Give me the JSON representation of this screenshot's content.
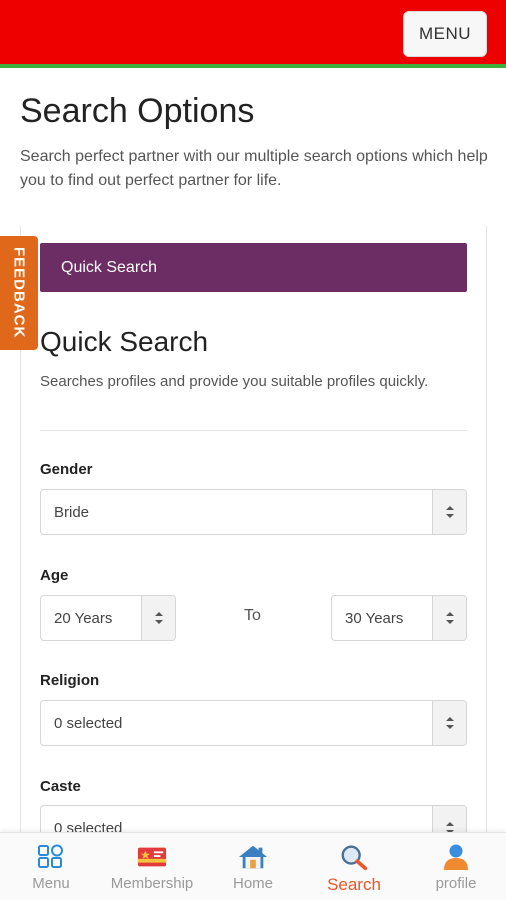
{
  "header": {
    "menu_label": "MENU"
  },
  "page": {
    "title": "Search Options",
    "description": "Search perfect partner with our multiple search options which help you to find out perfect partner for life."
  },
  "feedback_label": "FEEDBACK",
  "tab": {
    "label": "Quick Search"
  },
  "section": {
    "title": "Quick Search",
    "description": "Searches profiles and provide you suitable profiles quickly."
  },
  "form": {
    "gender": {
      "label": "Gender",
      "value": "Bride"
    },
    "age": {
      "label": "Age",
      "from": "20 Years",
      "to_label": "To",
      "to": "30 Years"
    },
    "religion": {
      "label": "Religion",
      "value": "0 selected"
    },
    "caste": {
      "label": "Caste",
      "value": "0 selected"
    }
  },
  "bottom_nav": {
    "items": [
      {
        "label": "Menu",
        "icon": "grid-icon"
      },
      {
        "label": "Membership",
        "icon": "membership-card-icon"
      },
      {
        "label": "Home",
        "icon": "home-icon"
      },
      {
        "label": "Search",
        "icon": "search-icon",
        "active": true
      },
      {
        "label": "profile",
        "icon": "profile-icon"
      }
    ]
  },
  "colors": {
    "header_bg": "#ee0000",
    "header_border": "#3fae3c",
    "tab_bg": "#6b2d63",
    "feedback_bg": "#e0681a",
    "active_nav": "#e8562a"
  }
}
